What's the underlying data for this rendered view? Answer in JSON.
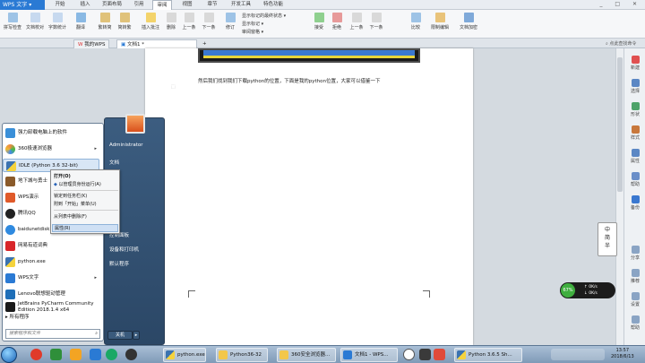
{
  "title_bar": {
    "app_name": "WPS 文字",
    "menu_tabs": [
      "开始",
      "插入",
      "页面布局",
      "引用",
      "审阅",
      "视图",
      "章节",
      "开发工具",
      "特色功能"
    ],
    "active_tab": "审阅",
    "window_controls": "_ □ ✕"
  },
  "ribbon": {
    "buttons": [
      "拼写检查",
      "文档校对",
      "字数统计",
      "翻译",
      "繁转简",
      "简转繁",
      "插入批注",
      "删除",
      "上一条",
      "下一条",
      "修订",
      "显示标记",
      "接受",
      "拒绝",
      "上一条",
      "下一条",
      "比较",
      "限制编辑",
      "文档加密"
    ],
    "dropdowns": [
      "显示标记的最终状态",
      "显示标记"
    ],
    "small_items": [
      "审阅",
      "审阅窗格"
    ]
  },
  "doc_tabs": {
    "tabs": [
      "我的WPS",
      "文档1 *"
    ],
    "new_tab_symbol": "+",
    "search_placeholder": "点此查找命令"
  },
  "document": {
    "text_line": "然后我们找到我们下载python的位置，下面是我的python位置，大家可以借鉴一下"
  },
  "right_sidebar": {
    "items": [
      "新建",
      "选择",
      "形状",
      "样式",
      "属性",
      "帮助",
      "备份",
      "分享",
      "推荐",
      "设置",
      "帮助"
    ]
  },
  "ime_badge": {
    "lines": [
      "中",
      "简",
      "半"
    ]
  },
  "net_widget": {
    "percent": "67%",
    "up": "0K/s",
    "down": "0K/s"
  },
  "start_menu": {
    "items": [
      {
        "label": "强力卸载电脑上的软件",
        "arrow": ""
      },
      {
        "label": "360极速浏览器",
        "arrow": "▸"
      },
      {
        "label": "IDLE (Python 3.6 32-bit)",
        "arrow": ""
      },
      {
        "label": "地下城与勇士",
        "arrow": ""
      },
      {
        "label": "WPS演示",
        "arrow": ""
      },
      {
        "label": "腾讯QQ",
        "arrow": ""
      },
      {
        "label": "baidunetdisk",
        "arrow": ""
      },
      {
        "label": "网易有道词典",
        "arrow": ""
      },
      {
        "label": "python.exe",
        "arrow": ""
      },
      {
        "label": "WPS文字",
        "arrow": "▸"
      },
      {
        "label": "Lenovo联想驱动管理",
        "arrow": ""
      },
      {
        "label_line1": "JetBrains PyCharm Community",
        "label_line2": "Edition 2018.1.4 x64",
        "arrow": ""
      }
    ],
    "all_programs": "所有程序",
    "search_placeholder": "搜索程序和文件",
    "right_items": [
      "Administrator",
      "文档",
      "机",
      "控制面板",
      "设备和打印机",
      "默认程序"
    ],
    "shutdown_label": "关机"
  },
  "context_menu": {
    "items": [
      "打开(O)",
      "以管理员身份运行(A)",
      "锁定到任务栏(K)",
      "附到「开始」菜单(U)",
      "从列表中删除(F)",
      "属性(R)"
    ]
  },
  "taskbar": {
    "tasks": [
      "python.exe",
      "Python36-32",
      "360安全浏览器...",
      "文档1 - WPS...",
      "Python 3.6.5 Sh..."
    ],
    "clock_time": "13:57",
    "clock_date": "2018/6/13"
  },
  "colors": {
    "wps_blue": "#2a7ad4",
    "start_menu_right": "#2b4766",
    "taskbar": "#7f9ab7",
    "highlight": "#d8e6f5"
  }
}
